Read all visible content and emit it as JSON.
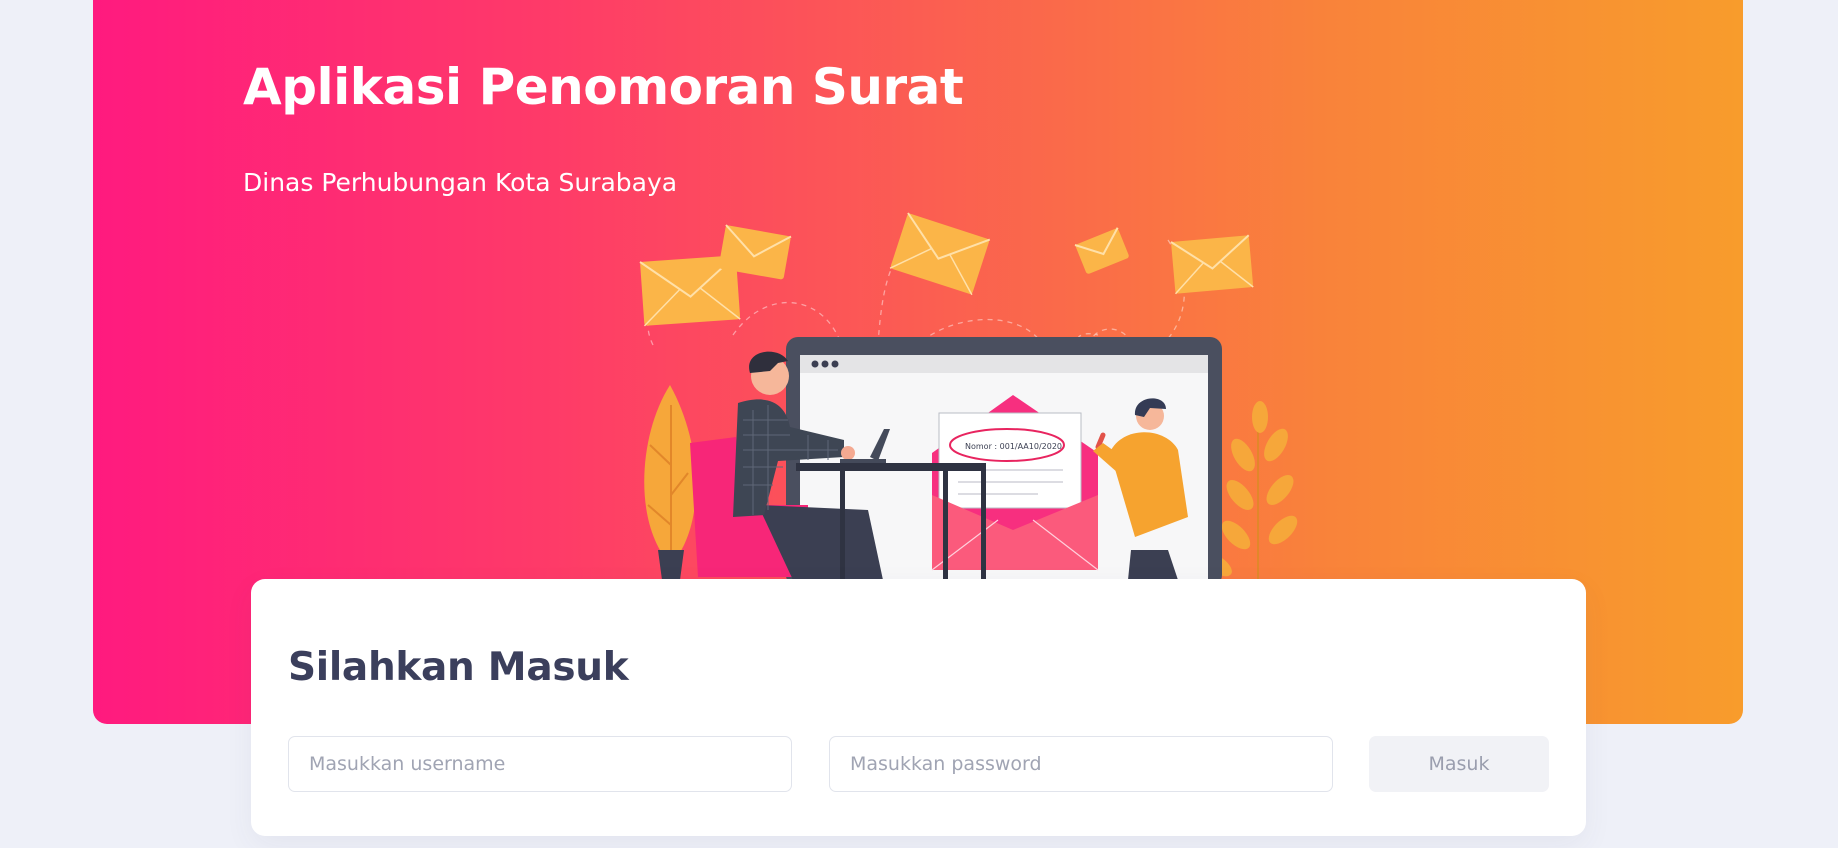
{
  "hero": {
    "title": "Aplikasi Penomoran Surat",
    "subtitle": "Dinas Perhubungan Kota Surabaya",
    "illustration": {
      "letter_number_text": "Nomor : 001/AA10/2020"
    }
  },
  "login": {
    "title": "Silahkan Masuk",
    "username_placeholder": "Masukkan username",
    "password_placeholder": "Masukkan password",
    "submit_label": "Masuk"
  },
  "colors": {
    "page_background": "#eef0f8",
    "gradient_start": "#ff1a7f",
    "gradient_end": "#f89c2c",
    "heading_text": "#3b3f5c",
    "button_background": "#f1f2f6",
    "envelope": "#fbb548"
  }
}
